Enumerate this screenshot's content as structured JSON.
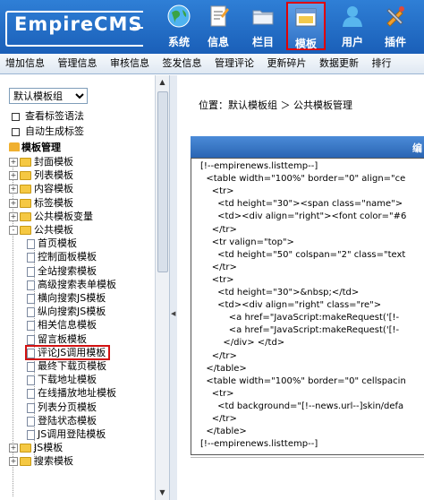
{
  "logo": {
    "text": "EmpireCMS"
  },
  "nav": [
    {
      "label": "系统",
      "icon": "globe-icon"
    },
    {
      "label": "信息",
      "icon": "document-icon"
    },
    {
      "label": "栏目",
      "icon": "folder-icon"
    },
    {
      "label": "模板",
      "icon": "window-icon",
      "active": true
    },
    {
      "label": "用户",
      "icon": "user-icon"
    },
    {
      "label": "插件",
      "icon": "tools-icon"
    }
  ],
  "submenu": [
    "增加信息",
    "管理信息",
    "审核信息",
    "签发信息",
    "管理评论",
    "更新碎片",
    "数据更新",
    "排行"
  ],
  "left": {
    "group_select": "默认模板组",
    "links": [
      "查看标签语法",
      "自动生成标签"
    ],
    "tree_title": "模板管理",
    "tree": [
      {
        "label": "封面模板",
        "type": "folder",
        "pm": "+"
      },
      {
        "label": "列表模板",
        "type": "folder",
        "pm": "+"
      },
      {
        "label": "内容模板",
        "type": "folder",
        "pm": "+"
      },
      {
        "label": "标签模板",
        "type": "folder",
        "pm": "+"
      },
      {
        "label": "公共模板变量",
        "type": "folder",
        "pm": "+"
      },
      {
        "label": "公共模板",
        "type": "folder",
        "pm": "-"
      },
      {
        "label": "首页模板",
        "type": "page"
      },
      {
        "label": "控制面板模板",
        "type": "page"
      },
      {
        "label": "全站搜索模板",
        "type": "page"
      },
      {
        "label": "高级搜索表单模板",
        "type": "page"
      },
      {
        "label": "横向搜索JS模板",
        "type": "page"
      },
      {
        "label": "纵向搜索JS模板",
        "type": "page"
      },
      {
        "label": "相关信息模板",
        "type": "page"
      },
      {
        "label": "留言板模板",
        "type": "page"
      },
      {
        "label": "评论JS调用模板",
        "type": "page",
        "selected": true
      },
      {
        "label": "最终下载页模板",
        "type": "page"
      },
      {
        "label": "下载地址模板",
        "type": "page"
      },
      {
        "label": "在线播放地址模板",
        "type": "page"
      },
      {
        "label": "列表分页模板",
        "type": "page"
      },
      {
        "label": "登陆状态模板",
        "type": "page"
      },
      {
        "label": "JS调用登陆模板",
        "type": "page"
      },
      {
        "label": "JS模板",
        "type": "folder",
        "pm": "+"
      },
      {
        "label": "搜索模板",
        "type": "folder",
        "pm": "+"
      }
    ]
  },
  "main": {
    "breadcrumb": "位置：默认模板组 ＞ 公共模板管理",
    "bar_title": "编",
    "code_lines": [
      "[!--empirenews.listtemp--]",
      "  <table width=\"100%\" border=\"0\" align=\"ce",
      "    <tr>",
      "      <td height=\"30\"><span class=\"name\">",
      "      <td><div align=\"right\"><font color=\"#6",
      "    </tr>",
      "    <tr valign=\"top\">",
      "      <td height=\"50\" colspan=\"2\" class=\"text",
      "    </tr>",
      "    <tr>",
      "      <td height=\"30\">&nbsp;</td>",
      "      <td><div align=\"right\" class=\"re\">",
      "          <a href=\"JavaScript:makeRequest('[!-",
      "          <a href=\"JavaScript:makeRequest('[!-",
      "        </div> </td>",
      "    </tr>",
      "  </table>",
      "  <table width=\"100%\" border=\"0\" cellspacin",
      "    <tr>",
      "      <td background=\"[!--news.url--]skin/defa",
      "    </tr>",
      "  </table>",
      "[!--empirenews.listtemp--]"
    ]
  }
}
